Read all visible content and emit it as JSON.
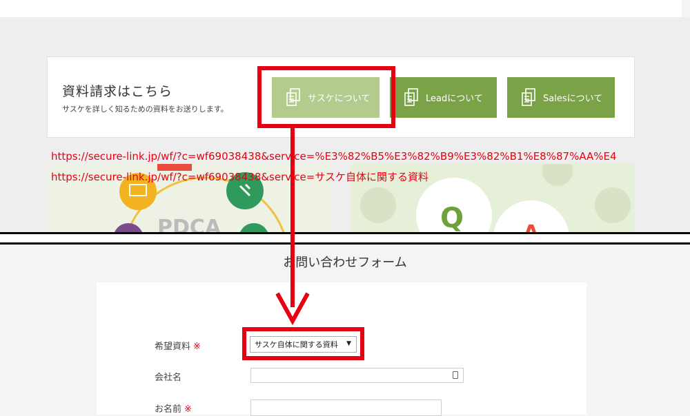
{
  "card": {
    "title": "資料請求はこちら",
    "subtitle": "サスケを詳しく知るための資料をお送りします。",
    "buttons": [
      {
        "label": "サスケについて",
        "icon": "document-icon"
      },
      {
        "label": "Leadについて",
        "icon": "document-icon"
      },
      {
        "label": "Salesについて",
        "icon": "document-icon"
      }
    ]
  },
  "annotations": {
    "url_encoded": "https://secure-link.jp/wf/?c=wf69038438&service=%E3%82%B5%E3%82%B9%E3%82%B1%E8%87%AA%E4",
    "url_decoded": "https://secure-link.jp/wf/?c=wf69038438&service=サスケ自体に関する資料",
    "highlight_color": "#e60012"
  },
  "promo": {
    "pdca_text": "PDCA",
    "q_text": "Q",
    "a_text": "A"
  },
  "form": {
    "title": "お問い合わせフォーム",
    "fields": {
      "material_label": "希望資料",
      "material_value": "サスケ自体に関する資料",
      "company_label": "会社名",
      "name_label": "お名前",
      "required_mark": "※"
    }
  },
  "colors": {
    "accent": "#7aa347",
    "accent_light": "#b3cc8e"
  }
}
